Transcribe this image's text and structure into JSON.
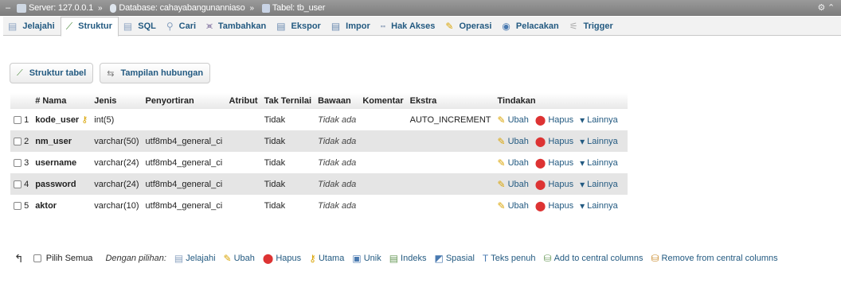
{
  "breadcrumb": {
    "server": "Server: 127.0.0.1",
    "database": "Database: cahayabangunanniaso",
    "table": "Tabel: tb_user",
    "separator": "»"
  },
  "tabs": [
    {
      "label": "Jelajahi",
      "icon": "browse-icon",
      "active": false
    },
    {
      "label": "Struktur",
      "icon": "structure-icon",
      "active": true
    },
    {
      "label": "SQL",
      "icon": "sql-icon",
      "active": false
    },
    {
      "label": "Cari",
      "icon": "search-icon",
      "active": false
    },
    {
      "label": "Tambahkan",
      "icon": "insert-icon",
      "active": false
    },
    {
      "label": "Ekspor",
      "icon": "export-icon",
      "active": false
    },
    {
      "label": "Impor",
      "icon": "import-icon",
      "active": false
    },
    {
      "label": "Hak Akses",
      "icon": "privileges-icon",
      "active": false
    },
    {
      "label": "Operasi",
      "icon": "wrench-icon",
      "active": false
    },
    {
      "label": "Pelacakan",
      "icon": "tracking-icon",
      "active": false
    },
    {
      "label": "Trigger",
      "icon": "trigger-icon",
      "active": false
    }
  ],
  "subtabs": {
    "structure": "Struktur tabel",
    "relations": "Tampilan hubungan"
  },
  "table": {
    "headers": {
      "num_name": "# Nama",
      "type": "Jenis",
      "collation": "Penyortiran",
      "attributes": "Atribut",
      "null": "Tak Ternilai",
      "default": "Bawaan",
      "comments": "Komentar",
      "extra": "Ekstra",
      "action": "Tindakan"
    },
    "rows": [
      {
        "num": "1",
        "name": "kode_user",
        "primary": true,
        "type": "int(5)",
        "collation": "",
        "attributes": "",
        "null": "Tidak",
        "default": "Tidak ada",
        "comments": "",
        "extra": "AUTO_INCREMENT"
      },
      {
        "num": "2",
        "name": "nm_user",
        "primary": false,
        "type": "varchar(50)",
        "collation": "utf8mb4_general_ci",
        "attributes": "",
        "null": "Tidak",
        "default": "Tidak ada",
        "comments": "",
        "extra": ""
      },
      {
        "num": "3",
        "name": "username",
        "primary": false,
        "type": "varchar(24)",
        "collation": "utf8mb4_general_ci",
        "attributes": "",
        "null": "Tidak",
        "default": "Tidak ada",
        "comments": "",
        "extra": ""
      },
      {
        "num": "4",
        "name": "password",
        "primary": false,
        "type": "varchar(24)",
        "collation": "utf8mb4_general_ci",
        "attributes": "",
        "null": "Tidak",
        "default": "Tidak ada",
        "comments": "",
        "extra": ""
      },
      {
        "num": "5",
        "name": "aktor",
        "primary": false,
        "type": "varchar(10)",
        "collation": "utf8mb4_general_ci",
        "attributes": "",
        "null": "Tidak",
        "default": "Tidak ada",
        "comments": "",
        "extra": ""
      }
    ],
    "row_actions": {
      "edit": "Ubah",
      "drop": "Hapus",
      "more": "Lainnya"
    }
  },
  "footer": {
    "check_all": "Pilih Semua",
    "with_selected": "Dengan pilihan:",
    "browse": "Jelajahi",
    "edit": "Ubah",
    "drop": "Hapus",
    "primary": "Utama",
    "unique": "Unik",
    "index": "Indeks",
    "spatial": "Spasial",
    "fulltext": "Teks penuh",
    "add_central": "Add to central columns",
    "remove_central": "Remove from central columns"
  },
  "colors": {
    "link": "#235a81",
    "breadcrumb_bg": "#8a8a8a",
    "row_alt": "#e5e5e5"
  }
}
